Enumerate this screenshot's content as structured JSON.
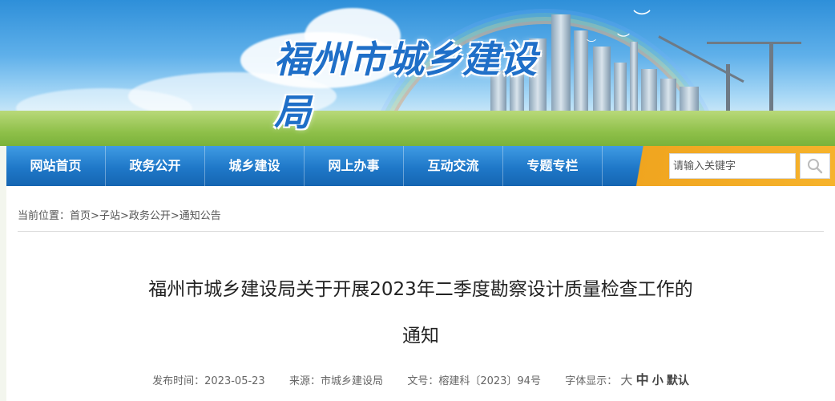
{
  "header": {
    "site_title": "福州市城乡建设局"
  },
  "nav": {
    "items": [
      {
        "label": "网站首页"
      },
      {
        "label": "政务公开"
      },
      {
        "label": "城乡建设"
      },
      {
        "label": "网上办事"
      },
      {
        "label": "互动交流"
      },
      {
        "label": "专题专栏"
      }
    ],
    "search": {
      "placeholder": "请输入关键字",
      "icon": "search-icon"
    },
    "accent_color": "#1f78c8",
    "search_band_color": "#f6b32c"
  },
  "breadcrumb": {
    "prefix": "当前位置：",
    "items": [
      "首页",
      "子站",
      "政务公开",
      "通知公告"
    ],
    "separator": ">"
  },
  "article": {
    "title_line1": "福州市城乡建设局关于开展2023年二季度勘察设计质量检查工作的",
    "title_line2": "通知",
    "meta": {
      "published_label": "发布时间：",
      "published_value": "2023-05-23",
      "source_label": "来源：",
      "source_value": "市城乡建设局",
      "doc_no_label": "文号：",
      "doc_no_value": "榕建科〔2023〕94号",
      "font_size_label": "字体显示：",
      "font_options": [
        "大",
        "中",
        "小",
        "默认"
      ]
    }
  }
}
